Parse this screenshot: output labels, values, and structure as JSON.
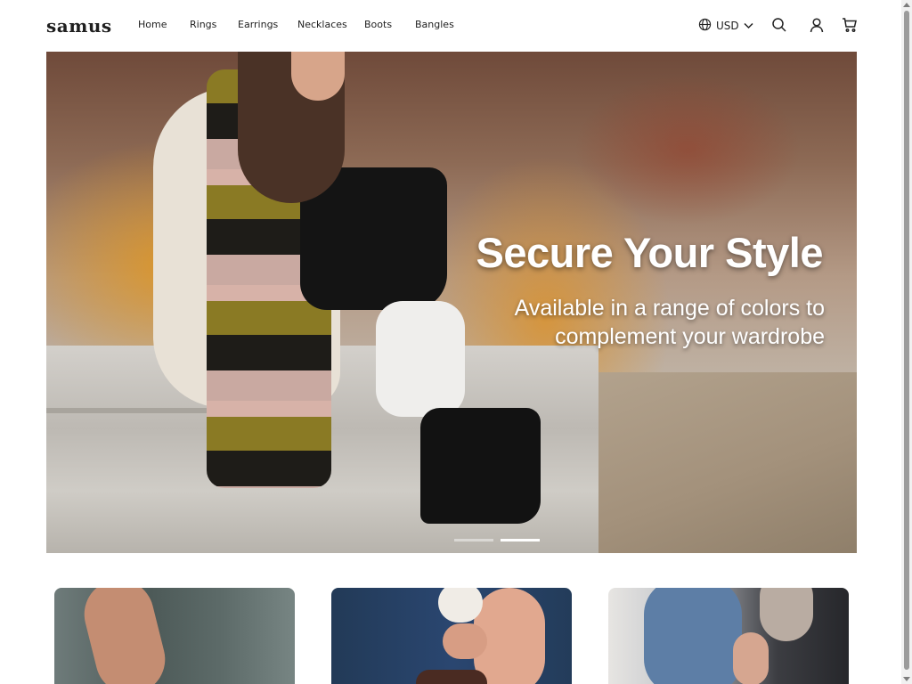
{
  "header": {
    "logo": "samus",
    "nav": [
      "Home",
      "Rings",
      "Earrings",
      "Necklaces",
      "Boots",
      "Bangles"
    ],
    "currency": "USD",
    "icons": {
      "globe": "globe-icon",
      "chevron": "chevron-down-icon",
      "search": "search-icon",
      "account": "user-icon",
      "cart": "cart-icon"
    }
  },
  "hero": {
    "title": "Secure Your Style",
    "subtitle": "Available in a range of colors to complement your wardrobe",
    "slides": 2,
    "active_slide": 2
  },
  "colors": {
    "text": "#1a1a1a",
    "hero_text": "#ffffff",
    "background": "#ffffff"
  }
}
